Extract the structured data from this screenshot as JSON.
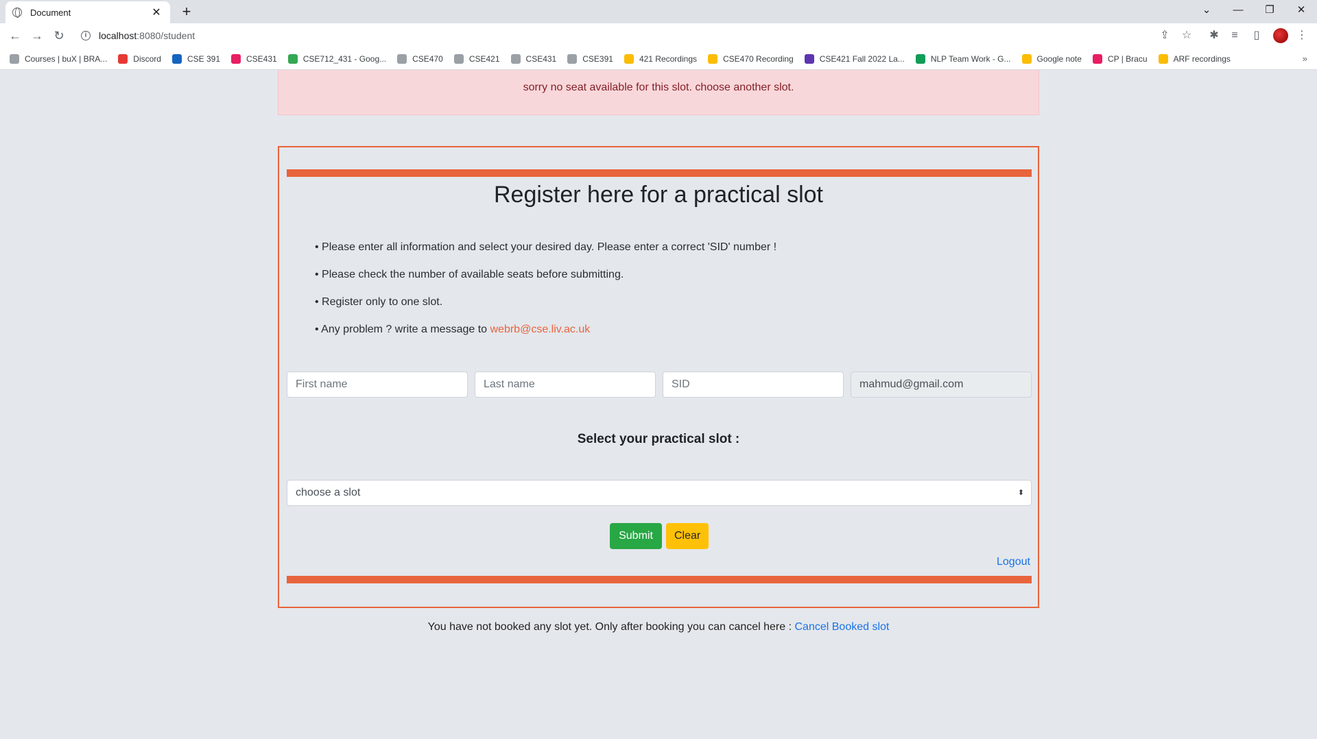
{
  "browser": {
    "tab_title": "Document",
    "url_host": "localhost",
    "url_path": ":8080/student",
    "bookmarks": [
      {
        "label": "Courses | buX | BRA...",
        "color": "#9aa0a6"
      },
      {
        "label": "Discord",
        "color": "#e53935"
      },
      {
        "label": "CSE 391",
        "color": "#1565c0"
      },
      {
        "label": "CSE431",
        "color": "#e91e63"
      },
      {
        "label": "CSE712_431 - Goog...",
        "color": "#34a853"
      },
      {
        "label": "CSE470",
        "color": "#9aa0a6"
      },
      {
        "label": "CSE421",
        "color": "#9aa0a6"
      },
      {
        "label": "CSE431",
        "color": "#9aa0a6"
      },
      {
        "label": "CSE391",
        "color": "#9aa0a6"
      },
      {
        "label": "421 Recordings",
        "color": "#fbbc04"
      },
      {
        "label": "CSE470 Recording",
        "color": "#fbbc04"
      },
      {
        "label": "CSE421 Fall 2022 La...",
        "color": "#5e35b1"
      },
      {
        "label": "NLP Team Work - G...",
        "color": "#0f9d58"
      },
      {
        "label": "Google note",
        "color": "#fbbc04"
      },
      {
        "label": "CP | Bracu",
        "color": "#e91e63"
      },
      {
        "label": "ARF recordings",
        "color": "#fbbc04"
      }
    ]
  },
  "alert": {
    "message": "sorry no seat available for this slot. choose another slot."
  },
  "form": {
    "title": "Register here for a practical slot",
    "instructions": [
      "• Please enter all information and select your desired day. Please enter a correct 'SID' number !",
      "• Please check the number of available seats before submitting.",
      "• Register only to one slot."
    ],
    "contact_prefix": "• Any problem ? write a message to ",
    "contact_email": "webrb@cse.liv.ac.uk",
    "first_name_placeholder": "First name",
    "last_name_placeholder": "Last name",
    "sid_placeholder": "SID",
    "email_value": "mahmud@gmail.com",
    "slot_heading": "Select your practical slot :",
    "slot_selected": "choose a slot",
    "submit_label": "Submit",
    "clear_label": "Clear",
    "logout_label": "Logout"
  },
  "footer": {
    "note": "You have not booked any slot yet. Only after booking you can cancel here : ",
    "cancel_link": "Cancel Booked slot"
  },
  "colors": {
    "accent": "#e8643c",
    "submit": "#28a745",
    "clear": "#ffc107",
    "link": "#1a73e8"
  }
}
